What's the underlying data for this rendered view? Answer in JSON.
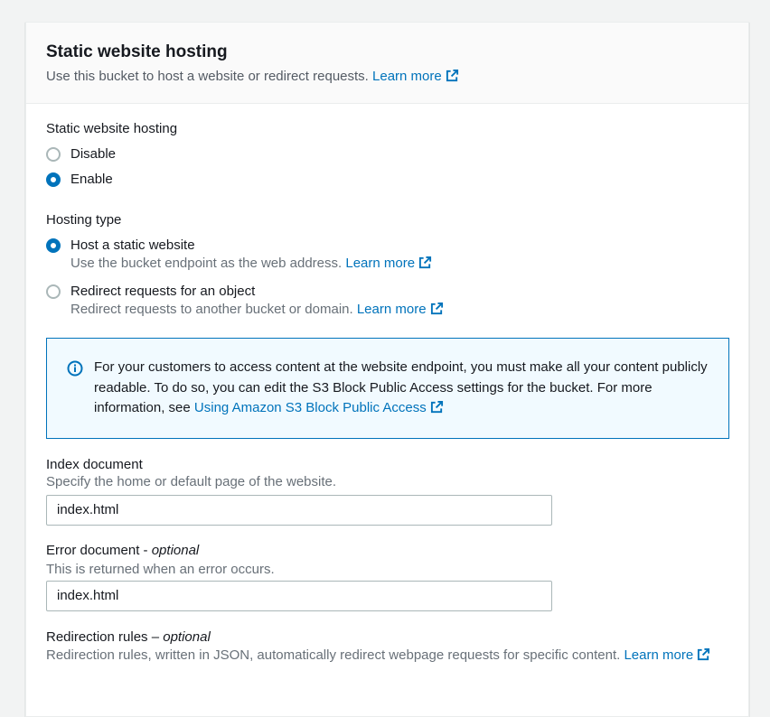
{
  "header": {
    "title": "Static website hosting",
    "description": "Use this bucket to host a website or redirect requests.",
    "learn_more": "Learn more"
  },
  "hosting": {
    "label": "Static website hosting",
    "options": [
      {
        "label": "Disable",
        "checked": false
      },
      {
        "label": "Enable",
        "checked": true
      }
    ]
  },
  "hosting_type": {
    "label": "Hosting type",
    "options": [
      {
        "label": "Host a static website",
        "description": "Use the bucket endpoint as the web address.",
        "learn_more": "Learn more",
        "checked": true
      },
      {
        "label": "Redirect requests for an object",
        "description": "Redirect requests to another bucket or domain.",
        "learn_more": "Learn more",
        "checked": false
      }
    ]
  },
  "alert": {
    "text": "For your customers to access content at the website endpoint, you must make all your content publicly readable. To do so, you can edit the S3 Block Public Access settings for the bucket. For more information, see",
    "link": "Using Amazon S3 Block Public Access"
  },
  "index_document": {
    "label": "Index document",
    "description": "Specify the home or default page of the website.",
    "value": "index.html"
  },
  "error_document": {
    "label": "Error document - ",
    "optional": "optional",
    "description": "This is returned when an error occurs.",
    "value": "index.html"
  },
  "redirection_rules": {
    "label": "Redirection rules – ",
    "optional": "optional",
    "description": "Redirection rules, written in JSON, automatically redirect webpage requests for specific content.",
    "learn_more": "Learn more"
  },
  "colors": {
    "link": "#0073bb",
    "radio_checked": "#0073bb",
    "alert_bg": "#f1faff",
    "alert_border": "#0073bb"
  },
  "icons": {
    "external": "external-link-icon",
    "info": "info-icon"
  }
}
